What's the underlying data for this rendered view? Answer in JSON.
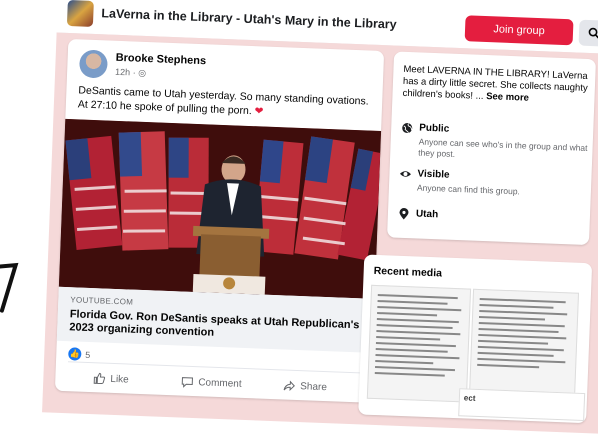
{
  "header": {
    "title": "LaVerna in the Library - Utah's Mary in the Library",
    "join_label": "Join group",
    "search_icon": "search-icon"
  },
  "post": {
    "author": "Brooke Stephens",
    "time": "12h",
    "text": "DeSantis came to Utah yesterday. So many standing ovations. At 27:10 he spoke of pulling the porn.",
    "link": {
      "domain": "YOUTUBE.COM",
      "title": "Florida Gov. Ron DeSantis speaks at Utah Republican's 2023 organizing convention"
    },
    "reaction_count": "5",
    "actions": {
      "like": "Like",
      "comment": "Comment",
      "share": "Share"
    }
  },
  "about": {
    "description": "Meet LAVERNA IN THE LIBRARY! LaVerna has a dirty little secret. She collects naughty children's books! ...",
    "see_more": "See more",
    "privacy": {
      "label": "Public",
      "desc": "Anyone can see who's in the group and what they post."
    },
    "visibility": {
      "label": "Visible",
      "desc": "Anyone can find this group."
    },
    "location": "Utah"
  },
  "media": {
    "title": "Recent media",
    "overlay_text": "ect"
  },
  "colors": {
    "accent": "#e41e3f",
    "link_blue": "#1877f2",
    "page_pink": "#f5d9d9"
  }
}
